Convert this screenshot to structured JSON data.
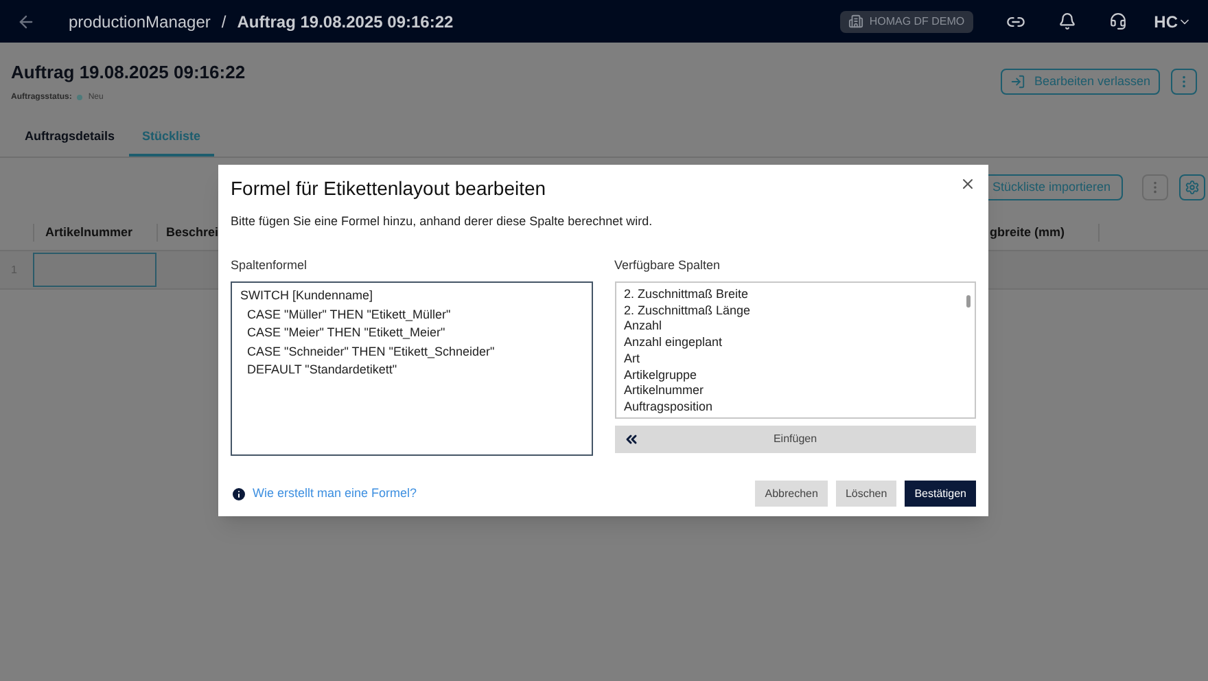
{
  "topbar": {
    "breadcrumb": [
      "productionManager",
      "Auftrag 19.08.2025 09:16:22"
    ],
    "separator": "/",
    "tenant": "HOMAG DF DEMO",
    "avatar": "HC"
  },
  "header": {
    "title": "Auftrag 19.08.2025 09:16:22",
    "status_label": "Auftragsstatus:",
    "status": "Neu",
    "exit_button": "Bearbeiten verlassen"
  },
  "tabs": [
    {
      "label": "Auftragsdetails",
      "selected": false
    },
    {
      "label": "Stückliste",
      "selected": true
    }
  ],
  "toolbar": {
    "import_button": "Stückliste importieren"
  },
  "table": {
    "columns": [
      "Artikelnummer",
      "Beschrei",
      "gbreite (mm)"
    ],
    "rows": [
      {
        "index": "1"
      }
    ]
  },
  "dialog": {
    "title": "Formel für Etikettenlayout bearbeiten",
    "subtitle": "Bitte fügen Sie eine Formel hinzu, anhand derer diese Spalte berechnet wird.",
    "formula_label": "Spaltenformel",
    "formula": "SWITCH [Kundenname]\n  CASE \"Müller\" THEN \"Etikett_Müller\"\n  CASE \"Meier\" THEN \"Etikett_Meier\"\n  CASE \"Schneider\" THEN \"Etikett_Schneider\"\n  DEFAULT \"Standardetikett\"",
    "columns_label": "Verfügbare Spalten",
    "columns": [
      "2. Zuschnittmaß Breite",
      "2. Zuschnittmaß Länge",
      "Anzahl",
      "Anzahl eingeplant",
      "Art",
      "Artikelgruppe",
      "Artikelnummer",
      "Auftragsposition"
    ],
    "insert_button": "Einfügen",
    "help_link": "Wie erstellt man eine Formel?",
    "buttons": [
      {
        "label": "Abbrechen",
        "kind": "secondary"
      },
      {
        "label": "Löschen",
        "kind": "secondary"
      },
      {
        "label": "Bestätigen",
        "kind": "primary"
      }
    ]
  }
}
